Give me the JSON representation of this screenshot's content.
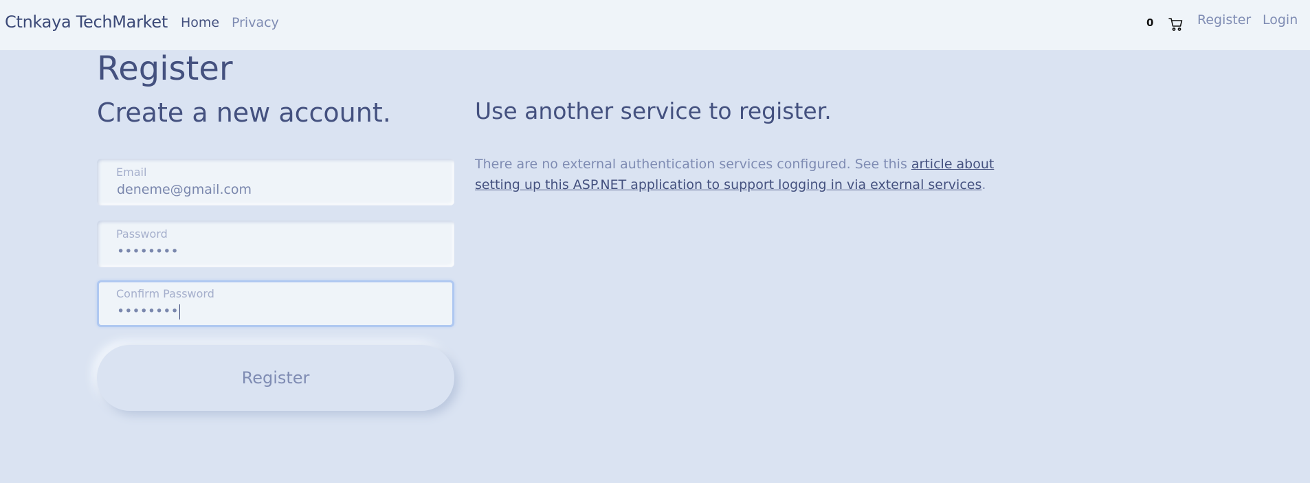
{
  "navbar": {
    "brand": "Ctnkaya TechMarket",
    "links": {
      "home": "Home",
      "privacy": "Privacy"
    },
    "cart_count": "0",
    "cart_icon": "cart-icon",
    "register": "Register",
    "login": "Login"
  },
  "main": {
    "title": "Register",
    "form": {
      "heading": "Create a new account.",
      "email": {
        "label": "Email",
        "value": "deneme@gmail.com"
      },
      "password": {
        "label": "Password",
        "value": "••••••••"
      },
      "confirm_password": {
        "label": "Confirm Password",
        "value": "••••••••"
      },
      "submit_label": "Register"
    },
    "external": {
      "heading": "Use another service to register.",
      "text_before": "There are no external authentication services configured. See this ",
      "link_text": "article about setting up this ASP.NET application to support logging in via external services",
      "text_after": "."
    }
  },
  "colors": {
    "background": "#dae3f2",
    "navbar": "#eff4f9",
    "text_dark": "#44517f",
    "text_muted": "#7f8cb3",
    "focus_border": "#afc8f1"
  }
}
